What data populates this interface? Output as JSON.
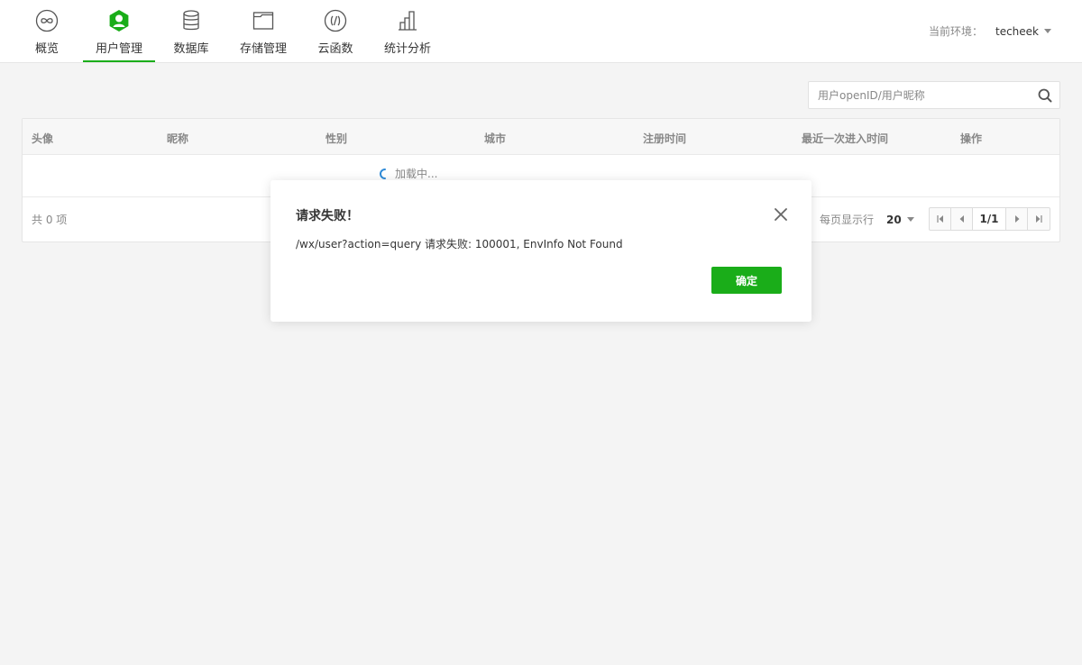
{
  "nav": {
    "items": [
      {
        "label": "概览",
        "icon": "infinity-icon"
      },
      {
        "label": "用户管理",
        "icon": "user-icon",
        "active": true
      },
      {
        "label": "数据库",
        "icon": "database-icon"
      },
      {
        "label": "存储管理",
        "icon": "folder-icon"
      },
      {
        "label": "云函数",
        "icon": "function-icon"
      },
      {
        "label": "统计分析",
        "icon": "bar-chart-icon"
      }
    ],
    "env_label": "当前环境：",
    "env_value": "techeek"
  },
  "search": {
    "placeholder": "用户openID/用户昵称"
  },
  "table": {
    "columns": [
      "头像",
      "昵称",
      "性别",
      "城市",
      "注册时间",
      "最近一次进入时间",
      "操作"
    ],
    "loading_text": "加载中...",
    "total_text": "共 0 项",
    "page_size_label": "每页显示行",
    "page_size_value": "20",
    "page_indicator": "1/1"
  },
  "dialog": {
    "title": "请求失败！",
    "message": "/wx/user?action=query 请求失败: 100001, EnvInfo Not Found",
    "ok_label": "确定"
  },
  "colors": {
    "accent": "#1aad19",
    "background": "#f4f4f4"
  }
}
